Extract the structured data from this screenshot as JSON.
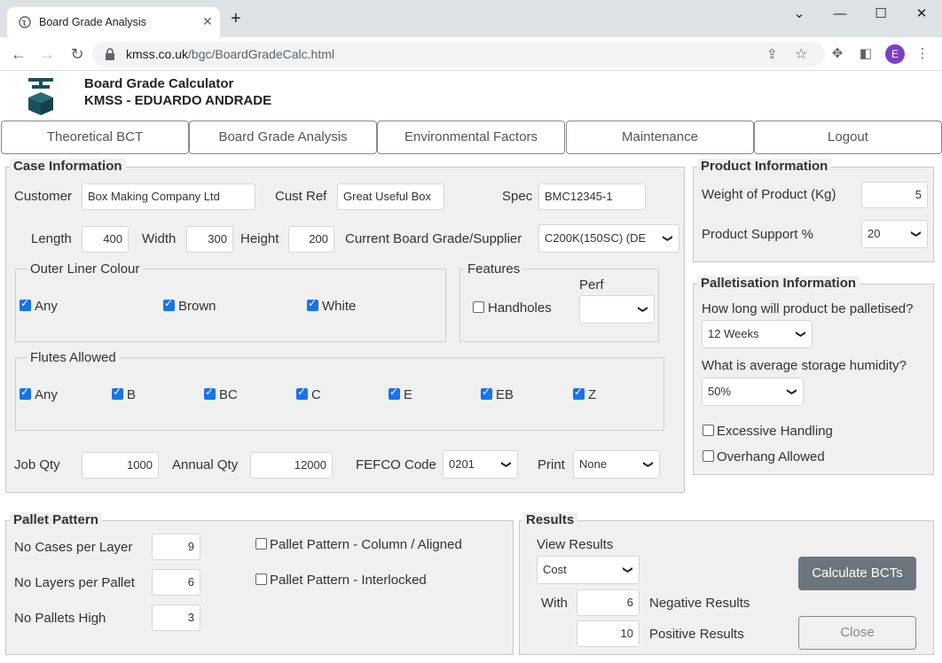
{
  "browser": {
    "tab_title": "Board Grade Analysis",
    "url_domain": "kmss.co.uk",
    "url_path": "/bgc/BoardGradeCalc.html",
    "avatar_letter": "E"
  },
  "header": {
    "title": "Board Grade Calculator",
    "user": "KMSS - EDUARDO ANDRADE"
  },
  "nav": [
    "Theoretical BCT",
    "Board Grade Analysis",
    "Environmental Factors",
    "Maintenance",
    "Logout"
  ],
  "case_info": {
    "legend": "Case Information",
    "customer_label": "Customer",
    "customer": "Box Making Company Ltd",
    "cust_ref_label": "Cust Ref",
    "cust_ref": "Great Useful Box",
    "spec_label": "Spec",
    "spec": "BMC12345-1",
    "length_label": "Length",
    "length": "400",
    "width_label": "Width",
    "width": "300",
    "height_label": "Height",
    "height": "200",
    "board_label": "Current Board Grade/Supplier",
    "board": "C200K(150SC) (DE",
    "outer_liner": {
      "legend": "Outer Liner Colour",
      "options": [
        {
          "label": "Any",
          "checked": true
        },
        {
          "label": "Brown",
          "checked": true
        },
        {
          "label": "White",
          "checked": true
        }
      ]
    },
    "features": {
      "legend": "Features",
      "handholes_label": "Handholes",
      "handholes_checked": false,
      "perf_label": "Perf",
      "perf_value": ""
    },
    "flutes": {
      "legend": "Flutes Allowed",
      "options": [
        {
          "label": "Any",
          "checked": true
        },
        {
          "label": "B",
          "checked": true
        },
        {
          "label": "BC",
          "checked": true
        },
        {
          "label": "C",
          "checked": true
        },
        {
          "label": "E",
          "checked": true
        },
        {
          "label": "EB",
          "checked": true
        },
        {
          "label": "Z",
          "checked": true
        }
      ]
    },
    "job_qty_label": "Job Qty",
    "job_qty": "1000",
    "annual_qty_label": "Annual Qty",
    "annual_qty": "12000",
    "fefco_label": "FEFCO Code",
    "fefco": "0201",
    "print_label": "Print",
    "print": "None"
  },
  "product_info": {
    "legend": "Product Information",
    "weight_label": "Weight of Product (Kg)",
    "weight": "5",
    "support_label": "Product Support %",
    "support": "20"
  },
  "palletisation": {
    "legend": "Palletisation Information",
    "duration_q": "How long will product be palletised?",
    "duration": "12 Weeks",
    "humidity_q": "What is average storage humidity?",
    "humidity": "50%",
    "excessive_label": "Excessive Handling",
    "excessive_checked": false,
    "overhang_label": "Overhang Allowed",
    "overhang_checked": false
  },
  "pallet_pattern": {
    "legend": "Pallet Pattern",
    "cases_label": "No Cases per Layer",
    "cases": "9",
    "layers_label": "No Layers per Pallet",
    "layers": "6",
    "pallets_label": "No Pallets High",
    "pallets": "3",
    "column_label": "Pallet Pattern - Column / Aligned",
    "interlocked_label": "Pallet Pattern - Interlocked"
  },
  "results": {
    "legend": "Results",
    "view_label": "View Results",
    "view": "Cost",
    "with_label": "With",
    "negative": "6",
    "negative_label": "Negative Results",
    "positive": "10",
    "positive_label": "Positive Results",
    "calculate_label": "Calculate BCTs",
    "close_label": "Close"
  },
  "colors": {
    "accent": "#1a73e8",
    "panel_bg": "#f0f0f0",
    "primary_button": "#6c757d"
  }
}
